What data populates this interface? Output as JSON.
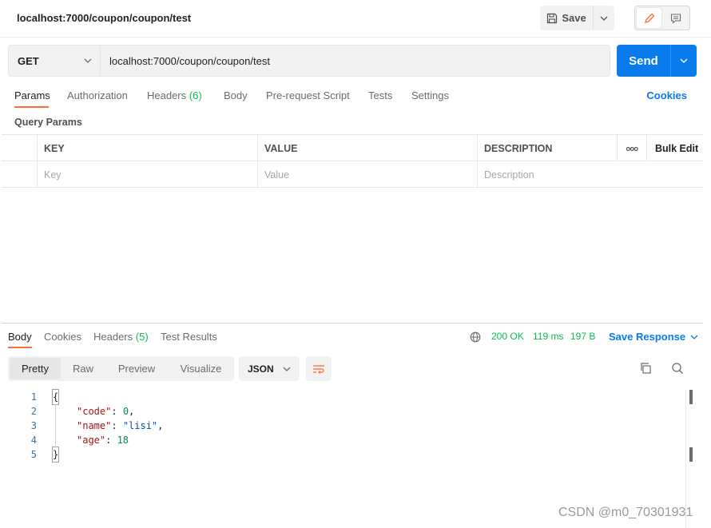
{
  "request": {
    "title": "localhost:7000/coupon/coupon/test",
    "save_label": "Save",
    "method": "GET",
    "url": "localhost:7000/coupon/coupon/test",
    "send_label": "Send"
  },
  "request_tabs": [
    {
      "label": "Params",
      "active": true
    },
    {
      "label": "Authorization"
    },
    {
      "label": "Headers",
      "count": "(6)"
    },
    {
      "label": "Body"
    },
    {
      "label": "Pre-request Script"
    },
    {
      "label": "Tests"
    },
    {
      "label": "Settings"
    }
  ],
  "cookies_label": "Cookies",
  "query_params": {
    "title": "Query Params",
    "columns": {
      "key": "KEY",
      "value": "VALUE",
      "description": "DESCRIPTION",
      "bulk_edit": "Bulk Edit",
      "more": "ooo"
    },
    "placeholders": {
      "key": "Key",
      "value": "Value",
      "description": "Description"
    }
  },
  "response": {
    "tabs": [
      {
        "label": "Body",
        "active": true
      },
      {
        "label": "Cookies"
      },
      {
        "label": "Headers",
        "count": "(5)"
      },
      {
        "label": "Test Results"
      }
    ],
    "status": "200 OK",
    "time": "119 ms",
    "size": "197 B",
    "save_response_label": "Save Response",
    "views": [
      "Pretty",
      "Raw",
      "Preview",
      "Visualize"
    ],
    "active_view": "Pretty",
    "format": "JSON",
    "lines": [
      {
        "n": "1",
        "text": "{"
      },
      {
        "n": "2",
        "key": "\"code\"",
        "sep": ": ",
        "val": "0",
        "trail": ","
      },
      {
        "n": "3",
        "key": "\"name\"",
        "sep": ": ",
        "val": "\"lisi\"",
        "trail": ","
      },
      {
        "n": "4",
        "key": "\"age\"",
        "sep": ": ",
        "val": "18",
        "trail": ""
      },
      {
        "n": "5",
        "text": "}"
      }
    ]
  },
  "watermark": "CSDN @m0_70301931",
  "colors": {
    "accent": "#ff6c37",
    "primary": "#097bed",
    "success": "#0cbb52"
  }
}
